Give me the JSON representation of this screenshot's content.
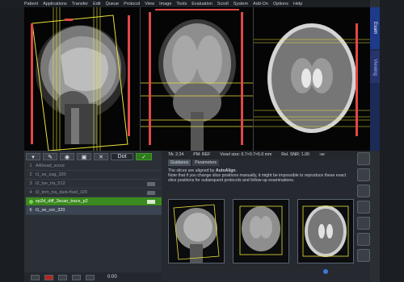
{
  "menu": [
    "Patient",
    "Applications",
    "Transfer",
    "Edit",
    "Queue",
    "Protocol",
    "View",
    "Image",
    "Tools",
    "Evaluation",
    "Scroll",
    "System",
    "Add-On",
    "Options",
    "Help"
  ],
  "right_tabs": {
    "exam": "Exam",
    "viewing": "Viewing"
  },
  "toolbar": {
    "dot_label": "Dot"
  },
  "protocols": [
    {
      "num": "1",
      "name": "AAhead_scout",
      "state": "done"
    },
    {
      "num": "2",
      "name": "t1_se_sag_320",
      "state": "done"
    },
    {
      "num": "3",
      "name": "t2_tse_tra_512",
      "state": "done"
    },
    {
      "num": "4",
      "name": "t2_tirm_tra_dark-fluid_320",
      "state": "done"
    },
    {
      "num": "5",
      "name": "ep2d_diff_3scan_trace_p2",
      "state": "active"
    },
    {
      "num": "6",
      "name": "t1_se_cor_320",
      "state": "selected"
    }
  ],
  "timer": "0:00",
  "status": {
    "ta": "TA: 2:24",
    "pm": "PM: REF",
    "voxel": "Voxel size: 0.7×0.7×5.0 mm",
    "snr": "Rel. SNR: 1.00",
    "se": ":se"
  },
  "subtabs": {
    "guidance": "Guidance",
    "parameters": "Parameters"
  },
  "guidance": {
    "line1_pre": "The slices are aligned by ",
    "line1_bold": "AutoAlign",
    "line1_post": ".",
    "line2": "Note that if you change slice positions manually, it might be impossible to reproduce these exact slice positions for subsequent protocols and follow-up examinations."
  },
  "colors": {
    "active_row": "#3b8a1f",
    "accent_tab": "#1e3a8a",
    "slice_yellow": "#e8e23a",
    "slice_red": "#e04848"
  }
}
